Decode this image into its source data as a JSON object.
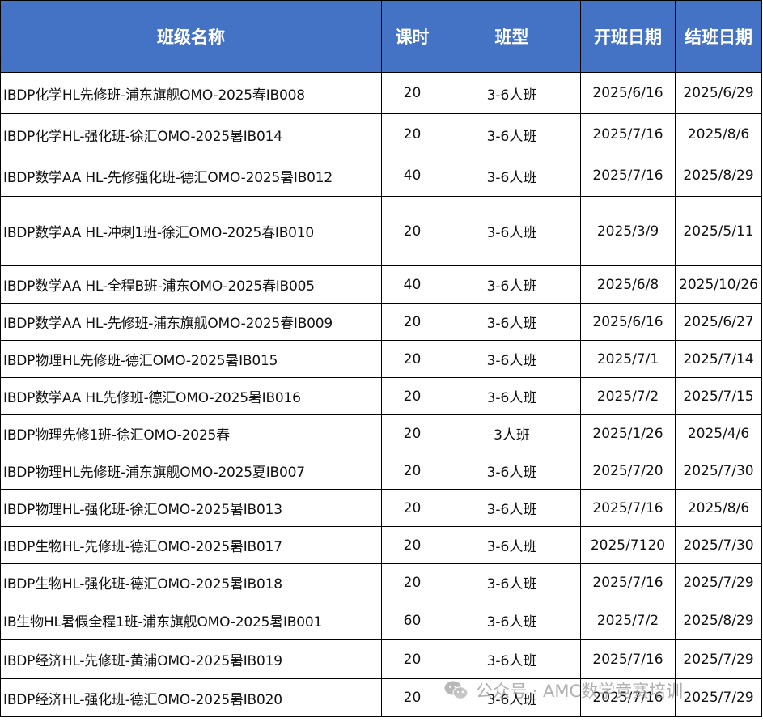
{
  "table": {
    "headers": [
      "班级名称",
      "课时",
      "班型",
      "开班日期",
      "结班日期"
    ],
    "rows": [
      [
        "IBDP化学HL先修班-浦东旗舰OMO-2025春IB008",
        "20",
        "3-6人班",
        "2025/6/16",
        "2025/6/29"
      ],
      [
        "IBDP化学HL-强化班-徐汇OMO-2025暑IB014",
        "20",
        "3-6人班",
        "2025/7/16",
        "2025/8/6"
      ],
      [
        "IBDP数学AA HL-先修强化班-德汇OMO-2025暑IB012",
        "40",
        "3-6人班",
        "2025/7/16",
        "2025/8/29"
      ],
      [
        "IBDP数学AA HL-冲刺1班-徐汇OMO-2025春IB010",
        "20",
        "3-6人班",
        "2025/3/9",
        "2025/5/11"
      ],
      [
        "IBDP数学AA HL-全程B班-浦东OMO-2025春IB005",
        "40",
        "3-6人班",
        "2025/6/8",
        "2025/10/26"
      ],
      [
        "IBDP数学AA HL-先修班-浦东旗舰OMO-2025春IB009",
        "20",
        "3-6人班",
        "2025/6/16",
        "2025/6/27"
      ],
      [
        "IBDP物理HL先修班-德汇OMO-2025暑IB015",
        "20",
        "3-6人班",
        "2025/7/1",
        "2025/7/14"
      ],
      [
        "IBDP数学AA HL先修班-德汇OMO-2025暑IB016",
        "20",
        "3-6人班",
        "2025/7/2",
        "2025/7/15"
      ],
      [
        "IBDP物理先修1班-徐汇OMO-2025春",
        "20",
        "3人班",
        "2025/1/26",
        "2025/4/6"
      ],
      [
        "IBDP物理HL先修班-浦东旗舰OMO-2025夏IB007",
        "20",
        "3-6人班",
        "2025/7/20",
        "2025/7/30"
      ],
      [
        "IBDP物理HL-强化班-徐汇OMO-2025暑IB013",
        "20",
        "3-6人班",
        "2025/7/16",
        "2025/8/6"
      ],
      [
        "IBDP生物HL-先修班-德汇OMO-2025暑IB017",
        "20",
        "3-6人班",
        "2025/7120",
        "2025/7/30"
      ],
      [
        "IBDP生物HL-强化班-德汇OMO-2025暑IB018",
        "20",
        "3-6人班",
        "2025/7/16",
        "2025/7/29"
      ],
      [
        "IB生物HL暑假全程1班-浦东旗舰OMO-2025暑IB001",
        "60",
        "3-6人班",
        "2025/7/2",
        "2025/8/29"
      ],
      [
        "IBDP经济HL-先修班-黄浦OMO-2025暑IB019",
        "20",
        "3-6人班",
        "2025/7/16",
        "2025/7/29"
      ],
      [
        "IBDP经济HL-强化班-德汇OMO-2025暑IB020",
        "20",
        "3-6人班",
        "2025/7/16",
        "2025/7/29"
      ]
    ]
  },
  "watermark": {
    "text": "公众号 · AMC数学竞赛培训",
    "icon": "wechat-icon"
  },
  "colors": {
    "header_bg": "#4472c4",
    "header_text": "#ffffff",
    "border": "#000000"
  }
}
